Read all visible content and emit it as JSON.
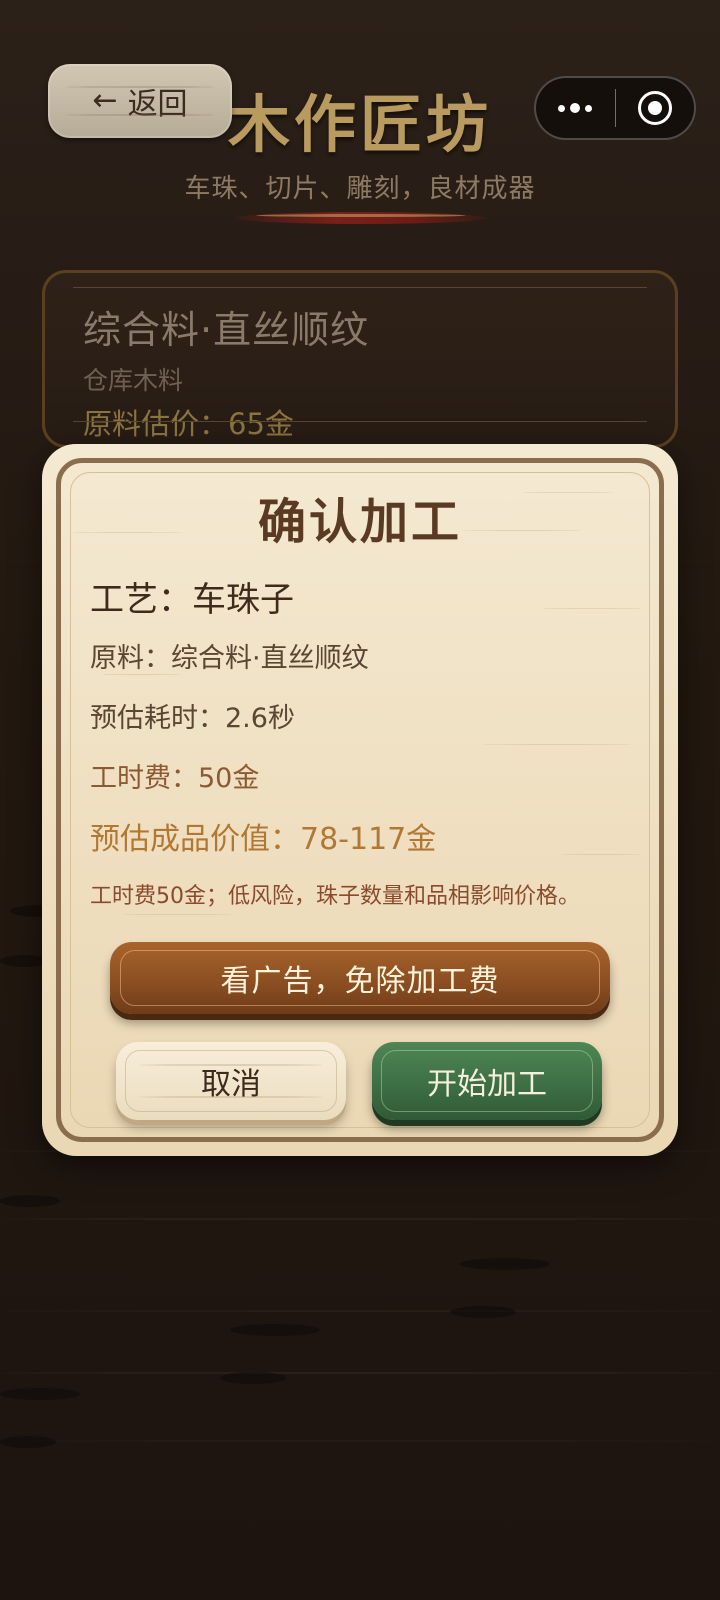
{
  "header": {
    "back_label": "返回",
    "back_icon": "arrow-left-icon",
    "title": "木作匠坊",
    "subtitle": "车珠、切片、雕刻，良材成器",
    "capsule": {
      "more_icon": "more-dots-icon",
      "close_icon": "target-circle-icon"
    }
  },
  "material": {
    "name": "综合料·直丝顺纹",
    "source": "仓库木料",
    "price": "原料估价：65金"
  },
  "dialog": {
    "title": "确认加工",
    "craft": "工艺：车珠子",
    "material": "原料：综合料·直丝顺纹",
    "time": "预估耗时：2.6秒",
    "fee": "工时费：50金",
    "value": "预估成品价值：78-117金",
    "note": "工时费50金；低风险，珠子数量和品相影响价格。",
    "ad_button": "看广告，免除加工费",
    "cancel_button": "取消",
    "start_button": "开始加工"
  },
  "colors": {
    "background": "#261c15",
    "title_gold": "#b99a5f",
    "dialog_paper": "#f2e5cb",
    "ad_button_wood": "#8c4f22",
    "start_button_green": "#3c6d43",
    "value_text": "#b07832"
  }
}
